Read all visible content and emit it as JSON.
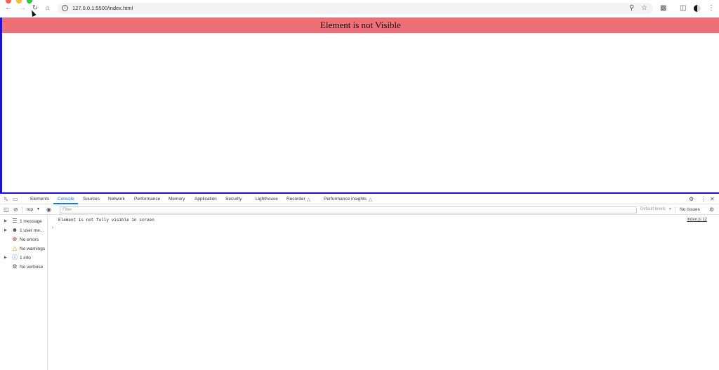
{
  "browser": {
    "url": "127.0.0.1:5500/index.html"
  },
  "page": {
    "banner_text": "Element is not Visible",
    "banner_color": "#ee7076",
    "frame_color": "#1a10e6"
  },
  "devtools": {
    "tabs": [
      "Elements",
      "Console",
      "Sources",
      "Network",
      "Performance",
      "Memory",
      "Application",
      "Security",
      "Lighthouse",
      "Recorder",
      "Performance insights"
    ],
    "active_tab": "Console",
    "context": "top",
    "filter_placeholder": "Filter",
    "levels_label": "Default levels",
    "issues_label": "No Issues",
    "sidebar": [
      {
        "label": "1 message",
        "icon": "list-icon"
      },
      {
        "label": "1 user me...",
        "icon": "user-icon"
      },
      {
        "label": "No errors",
        "icon": "error-icon"
      },
      {
        "label": "No warnings",
        "icon": "warning-icon"
      },
      {
        "label": "1 info",
        "icon": "info-icon"
      },
      {
        "label": "No verbose",
        "icon": "verbose-icon"
      }
    ],
    "messages": [
      {
        "text": "Element is not fully visible in screen",
        "source": "index.js:12"
      }
    ]
  }
}
